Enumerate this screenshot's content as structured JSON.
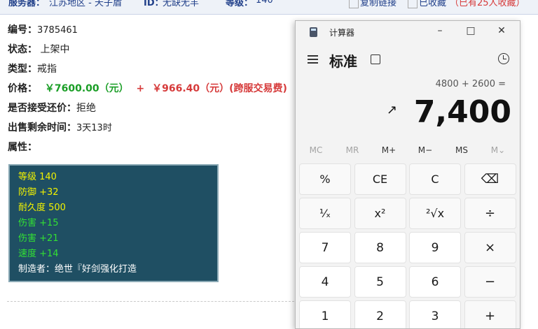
{
  "topbar": {
    "server_label": "服务器：",
    "server_value": "江苏地区 - 天子盾",
    "id_label": "ID：",
    "id_value": "无缺无羊",
    "level_label": "等级：",
    "level_value": "140",
    "copy_link": "复制链接",
    "favorited": "已收藏",
    "fav_count": "（已有25人收藏）"
  },
  "item": {
    "id_label": "编号：",
    "id_value": "3785461",
    "status_label": "状态：",
    "status_value": "上架中",
    "type_label": "类型：",
    "type_value": "戒指",
    "price_label": "价格：",
    "price_main": "￥7600.00（元）",
    "price_plus": "+",
    "price_fee": "￥966.40（元）(跨服交易费)",
    "counter_label": "是否接受还价：",
    "counter_value": "拒绝",
    "remaining_label": "出售剩余时间：",
    "remaining_value": "3天13时",
    "attr_label": "属性："
  },
  "attributes": [
    {
      "text": "等级 140",
      "color": "#f2f200"
    },
    {
      "text": "防御 +32",
      "color": "#f2f200"
    },
    {
      "text": "耐久度 500",
      "color": "#f2f200"
    },
    {
      "text": "伤害 +15",
      "color": "#33e033"
    },
    {
      "text": "伤害 +21",
      "color": "#33e033"
    },
    {
      "text": "速度 +14",
      "color": "#33e033"
    },
    {
      "text": "制造者：绝世『好剑强化打造",
      "color": "#ffffff"
    }
  ],
  "calculator": {
    "title": "计算器",
    "mode": "标准",
    "expression": "4800 + 2600 =",
    "result": "7,400",
    "memory": [
      "MC",
      "MR",
      "M+",
      "M−",
      "MS",
      "M⌄"
    ],
    "keys": [
      [
        "%",
        "CE",
        "C",
        "⌫"
      ],
      [
        "¹⁄ₓ",
        "x²",
        "²√x",
        "÷"
      ],
      [
        "7",
        "8",
        "9",
        "×"
      ],
      [
        "4",
        "5",
        "6",
        "−"
      ],
      [
        "1",
        "2",
        "3",
        "+"
      ]
    ],
    "icons": [
      "calculator-app-icon",
      "hamburger-menu-icon",
      "keep-on-top-icon",
      "history-icon"
    ]
  }
}
